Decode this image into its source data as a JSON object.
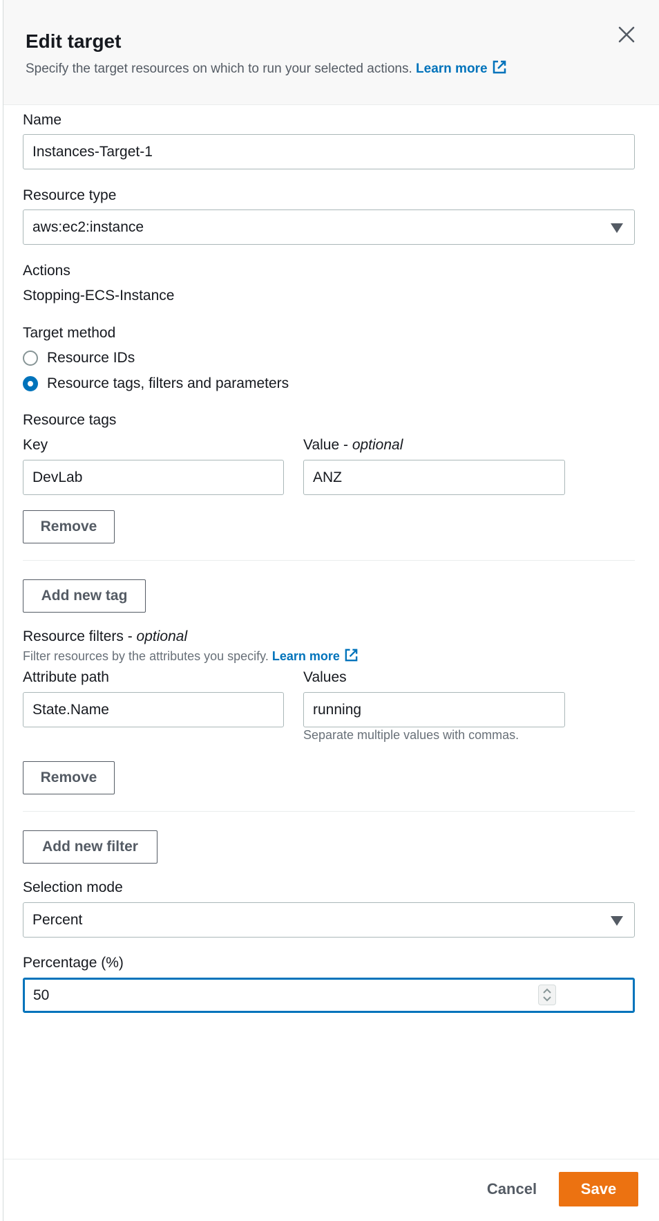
{
  "header": {
    "title": "Edit target",
    "subtitle": "Specify the target resources on which to run your selected actions.",
    "learn_more": "Learn more"
  },
  "name": {
    "label": "Name",
    "value": "Instances-Target-1"
  },
  "resource_type": {
    "label": "Resource type",
    "value": "aws:ec2:instance"
  },
  "actions": {
    "label": "Actions",
    "value": "Stopping-ECS-Instance"
  },
  "target_method": {
    "label": "Target method",
    "options": [
      "Resource IDs",
      "Resource tags, filters and parameters"
    ],
    "selected": "Resource tags, filters and parameters"
  },
  "resource_tags": {
    "label": "Resource tags",
    "key_label": "Key",
    "value_label": "Value - ",
    "value_label_optional": "optional",
    "key": "DevLab",
    "value": "ANZ",
    "remove_label": "Remove",
    "add_label": "Add new tag"
  },
  "resource_filters": {
    "label": "Resource filters - ",
    "label_optional": "optional",
    "description": "Filter resources by the attributes you specify.",
    "learn_more": "Learn more",
    "attribute_path_label": "Attribute path",
    "values_label": "Values",
    "attribute_path": "State.Name",
    "values": "running",
    "values_hint": "Separate multiple values with commas.",
    "remove_label": "Remove",
    "add_label": "Add new filter"
  },
  "selection_mode": {
    "label": "Selection mode",
    "value": "Percent"
  },
  "percentage": {
    "label": "Percentage (%)",
    "value": "50"
  },
  "footer": {
    "cancel_label": "Cancel",
    "save_label": "Save"
  },
  "colors": {
    "link": "#0073bb",
    "primary": "#ec7211",
    "focus": "#0073bb"
  }
}
